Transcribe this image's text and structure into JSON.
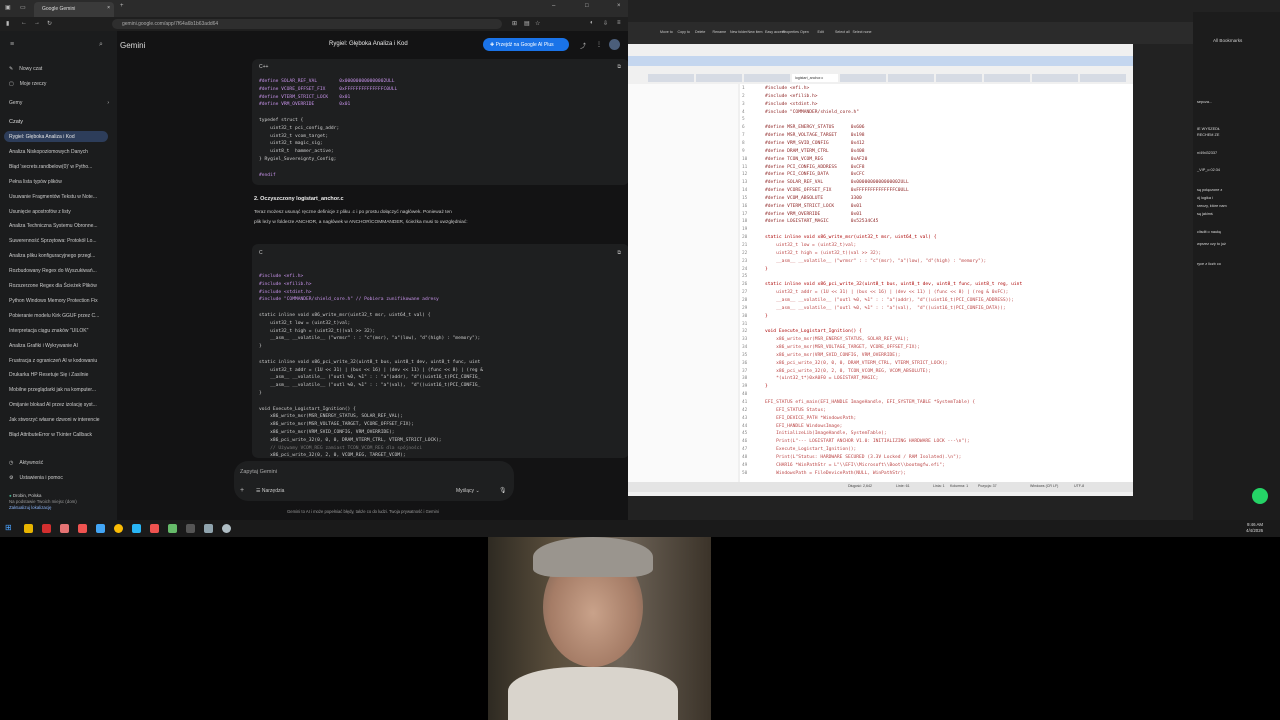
{
  "browser": {
    "tab_title": "Google Gemini",
    "url": "gemini.google.com/app/7f64a6b1b63add64"
  },
  "gemini": {
    "brand": "Gemini",
    "conversation_title": "Rygiel: Głęboka Analiza i Kod",
    "upgrade_button": "Przejdź na Google AI Plus",
    "sidebar": {
      "new_chat": "Nowy czat",
      "my_items": "Moje rzeczy",
      "gems": "Gemy",
      "chats_header": "Czaty",
      "chats": [
        "Rygiel: Głęboka Analiza i Kod",
        "Analiza Niskopoziomowych Danych",
        "Błąd 'secrets.randbelow(0)' w Pytho...",
        "Pełna lista typów plików",
        "Usuwanie Fragmentów Tekstu w Note...",
        "Usunięcie apostrofów z listy",
        "Analiza Techniczna Systemu Obronne...",
        "Suwerenność Sprzętowa: Protokół Lo...",
        "Analiza pliku konfiguracyjnego przegl...",
        "Rozbudowany Regex do Wyszukiwań...",
        "Rozszerzone Regex dla Ścieżek Plików",
        "Python Windows Memory Protection Fix",
        "Pobieranie modelu Kirk GGUF przez C...",
        "Interpretacja ciągu znaków \"UILOK\"",
        "Analiza Grafiki i Wykrywanie AI",
        "Frustracja z ograniczeń AI w kodowaniu",
        "Drukarka HP Resetuje Się i Zasilnie",
        "Mobilne przeglądarki jak na komputer...",
        "Omijanie blokad AI przez izolację syst...",
        "Jak stworzyć własne dzwoni w interencie",
        "Błąd AttributeError w Tkinter Callback"
      ],
      "activity": "Aktywność",
      "settings": "Ustawienia i pomoc",
      "location": "Drobin, Polska",
      "location_sub": "Na podstawie Twoich miejsc (dom)",
      "location_link": "Zaktualizuj lokalizację"
    },
    "code1_lang": "C++",
    "code1": [
      "#define SOLAR_REF_VAL        0x000000000000002ULL",
      "#define VCORE_OFFSET_FIX     0xFFFFFFFFFFFFFFC0ULL",
      "#define VTERM_STRICT_LOCK    0x01",
      "#define VRM_OVERRIDE         0x01",
      "",
      "typedef struct {",
      "    uint32_t pci_config_addr;",
      "    uint32_t vcom_target;",
      "    uint32_t magic_sig;",
      "    uint8_t  hammer_active;",
      "} Rygiel_Sovereignty_Config;",
      "",
      "#endif"
    ],
    "section_heading": "2. Oczyszczony logistart_anchor.c",
    "section_text_1": "Teraz możesz usunąć ręczne definicje z pliku .c i po prostu dołączyć nagłówek. Ponieważ ten",
    "section_text_2": "plik leży w folderze ANCHOR, a nagłówek w ANCHOR\\COMMANDER, ścieżka musi to uwzględniać:",
    "code2_lang": "C",
    "code2": [
      "#include <efi.h>",
      "#include <efilib.h>",
      "#include <stdint.h>",
      "#include \"COMMANDER/shield_core.h\" // Pobiera zunifikowane adresy",
      "",
      "static inline void x86_write_msr(uint32_t msr, uint64_t val) {",
      "    uint32_t low = (uint32_t)val;",
      "    uint32_t high = (uint32_t)(val >> 32);",
      "    __asm__ __volatile__ (\"wrmsr\" : : \"c\"(msr), \"a\"(low), \"d\"(high) : \"memory\");",
      "}",
      "",
      "static inline void x86_pci_write_32(uint8_t bus, uint8_t dev, uint8_t func, uint",
      "    uint32_t addr = (1U << 31) | (bus << 16) | (dev << 11) | (func << 8) | (reg &",
      "    __asm__ __volatile__ (\"outl %0, %1\" : : \"a\"(addr), \"d\"((uint16_t)PCI_CONFIG_",
      "    __asm__ __volatile__ (\"outl %0, %1\" : : \"a\"(val),  \"d\"((uint16_t)PCI_CONFIG_",
      "}",
      "",
      "void Execute_Logistart_Ignition() {",
      "    x86_write_msr(MSR_ENERGY_STATUS, SOLAR_REF_VAL);",
      "    x86_write_msr(MSR_VOLTAGE_TARGET, VCORE_OFFSET_FIX);",
      "    x86_write_msr(VRM_SVID_CONFIG, VRM_OVERRIDE);",
      "    x86_pci_write_32(0, 0, 0, DRAM_VTERM_CTRL, VTERM_STRICT_LOCK);",
      "    // Używamy VCOM_REG zamiast TCON_VCOM_REG dla spójności",
      "    x86_pci_write_32(0, 2, 0, VCOM_REG, TARGET_VCOM);"
    ],
    "prompt_placeholder": "Zapytaj Gemini",
    "tools_label": "Narzędzia",
    "mode_label": "Myślący",
    "disclaimer": "Gemini to AI i może popełniać błędy, także co do ludzi. Twoja prywatność i Gemini"
  },
  "editor": {
    "ribbon": [
      "Move to",
      "Copy to",
      "Delete",
      "Rename",
      "New folder",
      "New item",
      "Easy access",
      "Properties",
      "Open",
      "Edit",
      "Select all",
      "Select none"
    ],
    "tabs": [
      "",
      "",
      "",
      "logistart_anchor.c",
      "",
      "",
      "",
      "",
      "",
      ""
    ],
    "lines": [
      "#include <efi.h>",
      "#include <efilib.h>",
      "#include <stdint.h>",
      "#include \"COMMANDER/shield_core.h\"",
      "",
      "#define MSR_ENERGY_STATUS      0x606",
      "#define MSR_VOLTAGE_TARGET     0x198",
      "#define VRM_SVID_CONFIG        0x412",
      "#define DRAM_VTERM_CTRL        0x408",
      "#define TCON_VCOM_REG          0xAF20",
      "#define PCI_CONFIG_ADDRESS     0xCF8",
      "#define PCI_CONFIG_DATA        0xCFC",
      "#define SOLAR_REF_VAL          0x0000000000000002ULL",
      "#define VCORE_OFFSET_FIX       0xFFFFFFFFFFFFFFC0ULL",
      "#define VCOM_ABSOLUTE          3300",
      "#define VTERM_STRICT_LOCK      0x01",
      "#define VRM_OVERRIDE           0x01",
      "#define LOGISTART_MAGIC        0x52534C45",
      "",
      "static inline void x86_write_msr(uint32_t msr, uint64_t val) {",
      "    uint32_t low = (uint32_t)val;",
      "    uint32_t high = (uint32_t)(val >> 32);",
      "    __asm__ __volatile__ (\"wrmsr\" : : \"c\"(msr), \"a\"(low), \"d\"(high) : \"memory\");",
      "}",
      "",
      "static inline void x86_pci_write_32(uint8_t bus, uint8_t dev, uint8_t func, uint8_t reg, uint",
      "    uint32_t addr = (1U << 31) | (bus << 16) | (dev << 11) | (func << 8) | (reg & 0xFC);",
      "    __asm__ __volatile__ (\"outl %0, %1\" : : \"a\"(addr), \"d\"((uint16_t)PCI_CONFIG_ADDRESS));",
      "    __asm__ __volatile__ (\"outl %0, %1\" : : \"a\"(val),  \"d\"((uint16_t)PCI_CONFIG_DATA));",
      "}",
      "",
      "void Execute_Logistart_Ignition() {",
      "    x86_write_msr(MSR_ENERGY_STATUS, SOLAR_REF_VAL);",
      "    x86_write_msr(MSR_VOLTAGE_TARGET, VCORE_OFFSET_FIX);",
      "    x86_write_msr(VRM_SVID_CONFIG, VRM_OVERRIDE);",
      "    x86_pci_write_32(0, 0, 0, DRAM_VTERM_CTRL, VTERM_STRICT_LOCK);",
      "    x86_pci_write_32(0, 2, 0, TCON_VCOM_REG, VCOM_ABSOLUTE);",
      "    *(uint32_t*)0xA0F0 = LOGISTART_MAGIC;",
      "}",
      "",
      "EFI_STATUS efi_main(EFI_HANDLE ImageHandle, EFI_SYSTEM_TABLE *SystemTable) {",
      "    EFI_STATUS Status;",
      "    EFI_DEVICE_PATH *WindowsPath;",
      "    EFI_HANDLE WindowsImage;",
      "    InitializeLib(ImageHandle, SystemTable);",
      "    Print(L\"--- LOGISTART ANCHOR V1.0: INITIALIZING HARDWARE LOCK ---\\n\");",
      "    Execute_Logistart_Ignition();",
      "    Print(L\"Status: HARDWARE SECURED (3.3V Locked / RAM Isolated).\\n\");",
      "    CHAR16 *WinPathStr = L\"\\\\EFI\\\\Microsoft\\\\Boot\\\\bootmgfw.efi\";",
      "    WindowsPath = FileDevicePath(NULL, WinPathStr);"
    ],
    "status": [
      "Długość: 2,642",
      "Linie: 61",
      "Linia: 1",
      "Kolumna: 1",
      "Pozycja: 37",
      "Windows (CR LF)",
      "UTF-8"
    ]
  },
  "right_app": {
    "folder": "All Bookmarks",
    "snippets": [
      "sepcza...",
      "IE WYSZEDŁ",
      "RECHEM ZE",
      "n/49d32337",
      "_VIP_o 02:34",
      "są połączone z",
      "ój logika i",
      "rzeczy, które nam",
      "są jakimś",
      "clisdit o naukę",
      "wprzez czy to już",
      "ryce z liczb co"
    ]
  },
  "taskbar": {
    "time": "9:46 AM",
    "date": "4/4/2026"
  }
}
